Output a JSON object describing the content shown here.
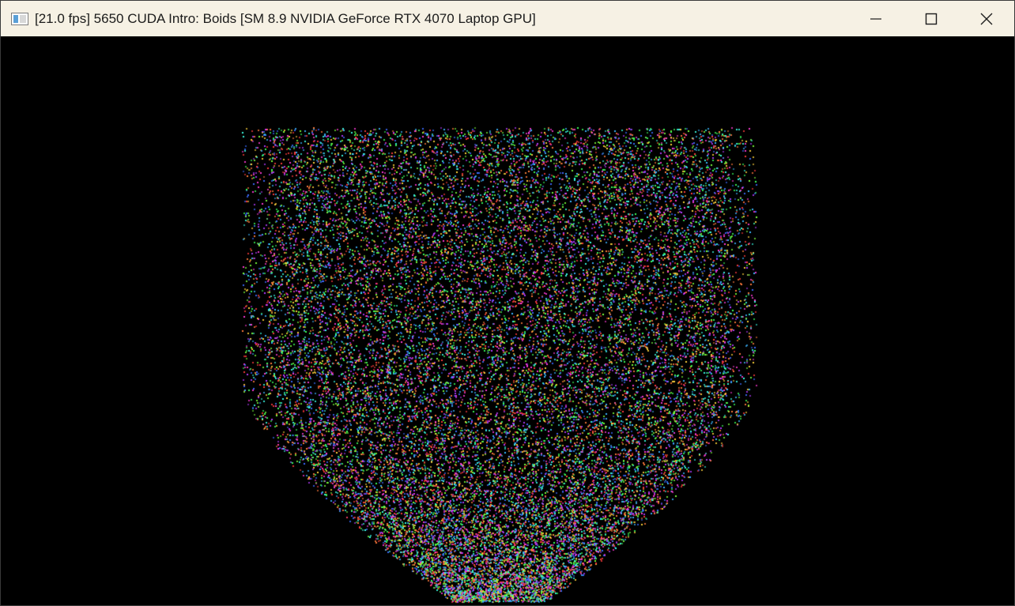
{
  "window": {
    "title": "[21.0 fps] 5650 CUDA Intro: Boids [SM 8.9 NVIDIA GeForce RTX 4070 Laptop GPU]",
    "icon": "app-window-icon",
    "controls": {
      "minimize_icon": "minimize-icon",
      "maximize_icon": "maximize-icon",
      "close_icon": "close-icon"
    }
  },
  "viewport": {
    "background": "#000000",
    "content": "boid-particle-cloud",
    "particle_colors": [
      "#ff3b3b",
      "#3bff5a",
      "#3b6bff",
      "#ff3bd8",
      "#3bffe6",
      "#b43bff",
      "#ffd23b",
      "#ff7a3b",
      "#7aff3b",
      "#3bb4ff"
    ]
  },
  "theme": {
    "titlebar_bg": "#f6f1e4",
    "titlebar_text": "#1b1b1b"
  }
}
